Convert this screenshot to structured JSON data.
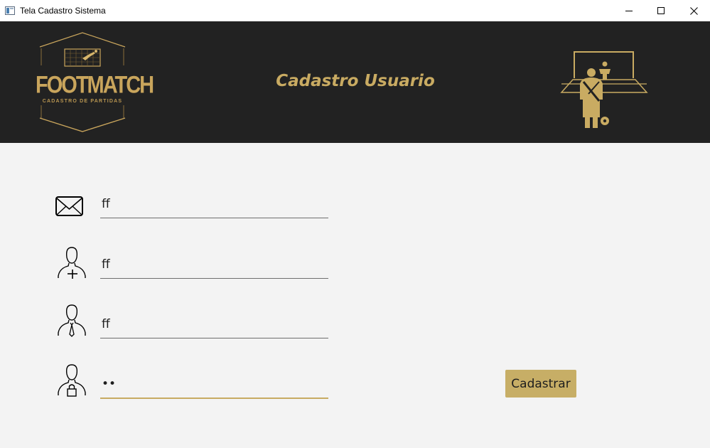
{
  "window": {
    "title": "Tela Cadastro Sistema"
  },
  "header": {
    "logo_text": "FOOTMATCH",
    "logo_tagline": "CADASTRO DE PARTIDAS",
    "title": "Cadastro Usuario"
  },
  "form": {
    "email": {
      "value": "ff",
      "icon": "envelope-icon"
    },
    "name": {
      "value": "ff",
      "icon": "user-add-icon"
    },
    "username": {
      "value": "ff",
      "icon": "user-tie-icon"
    },
    "password": {
      "value": "••",
      "icon": "user-lock-icon"
    },
    "submit_label": "Cadastrar"
  },
  "colors": {
    "accent": "#c7ae66",
    "header_bg": "#222222",
    "page_bg": "#f3f3f3"
  }
}
